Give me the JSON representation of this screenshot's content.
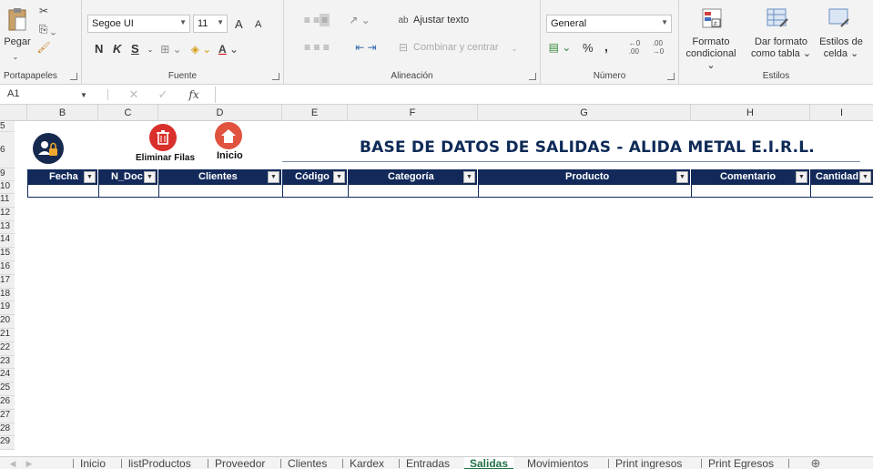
{
  "ribbon": {
    "clipboard": {
      "paste": "Pegar",
      "label": "Portapapeles"
    },
    "font": {
      "name": "Segoe UI",
      "size": "11",
      "bold": "N",
      "italic": "K",
      "underline": "S",
      "label": "Fuente",
      "grow": "A",
      "shrink": "A"
    },
    "alignment": {
      "wrap": "Ajustar texto",
      "merge": "Combinar y centrar",
      "label": "Alineación"
    },
    "number": {
      "format": "General",
      "percent": "%",
      "comma": ",",
      "label": "Número"
    },
    "styles": {
      "cond1": "Formato",
      "cond2": "condicional",
      "table1": "Dar formato",
      "table2": "como tabla",
      "cell1": "Estilos de",
      "cell2": "celda",
      "label": "Estilos"
    }
  },
  "formula_bar": {
    "name_box": "A1",
    "fx": "fx",
    "value": ""
  },
  "columns": [
    "B",
    "C",
    "D",
    "E",
    "F",
    "G",
    "H",
    "I"
  ],
  "rows": [
    "5",
    "6",
    "9",
    "10",
    "11",
    "12",
    "13",
    "14",
    "15",
    "16",
    "17",
    "18",
    "19",
    "20",
    "21",
    "22",
    "23",
    "24",
    "25",
    "26",
    "27",
    "28",
    "29"
  ],
  "sheet": {
    "title": "BASE DE DATOS DE SALIDAS - ALIDA METAL E.I.R.L.",
    "delete_label": "Eliminar Filas",
    "home_label": "Inicio",
    "headers": [
      "Fecha",
      "N_Doc",
      "Clientes",
      "Código",
      "Categoría",
      "Producto",
      "Comentario",
      "Cantidad"
    ]
  },
  "tabs": [
    "Inicio",
    "listProductos",
    "Proveedor",
    "Clientes",
    "Kardex",
    "Entradas",
    "Salidas",
    "Movimientos",
    "Print ingresos",
    "Print Egresos"
  ],
  "active_tab": "Salidas",
  "colors": {
    "header_navy": "#12295a",
    "excel_green": "#217346",
    "delete_red": "#d9302c",
    "home_red": "#e0533e"
  }
}
